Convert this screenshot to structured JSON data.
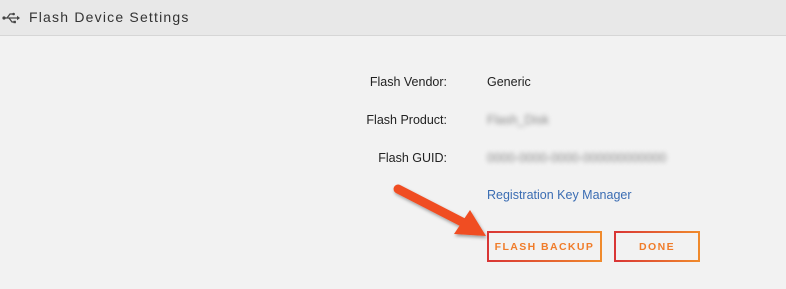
{
  "header": {
    "title": "Flash Device Settings",
    "icon": "usb-icon"
  },
  "fields": [
    {
      "label": "Flash Vendor:",
      "value": "Generic"
    },
    {
      "label": "Flash Product:",
      "value": "Flash_Disk"
    },
    {
      "label": "Flash GUID:",
      "value": "0000-0000-0000-000000000000"
    }
  ],
  "link": {
    "label": "Registration Key Manager"
  },
  "buttons": {
    "backup_label": "FLASH BACKUP",
    "done_label": "DONE"
  },
  "colors": {
    "accent": "#f07c2a",
    "button_border_start": "#d93535",
    "link": "#3b6db3",
    "annotation_arrow": "#f04e23"
  }
}
